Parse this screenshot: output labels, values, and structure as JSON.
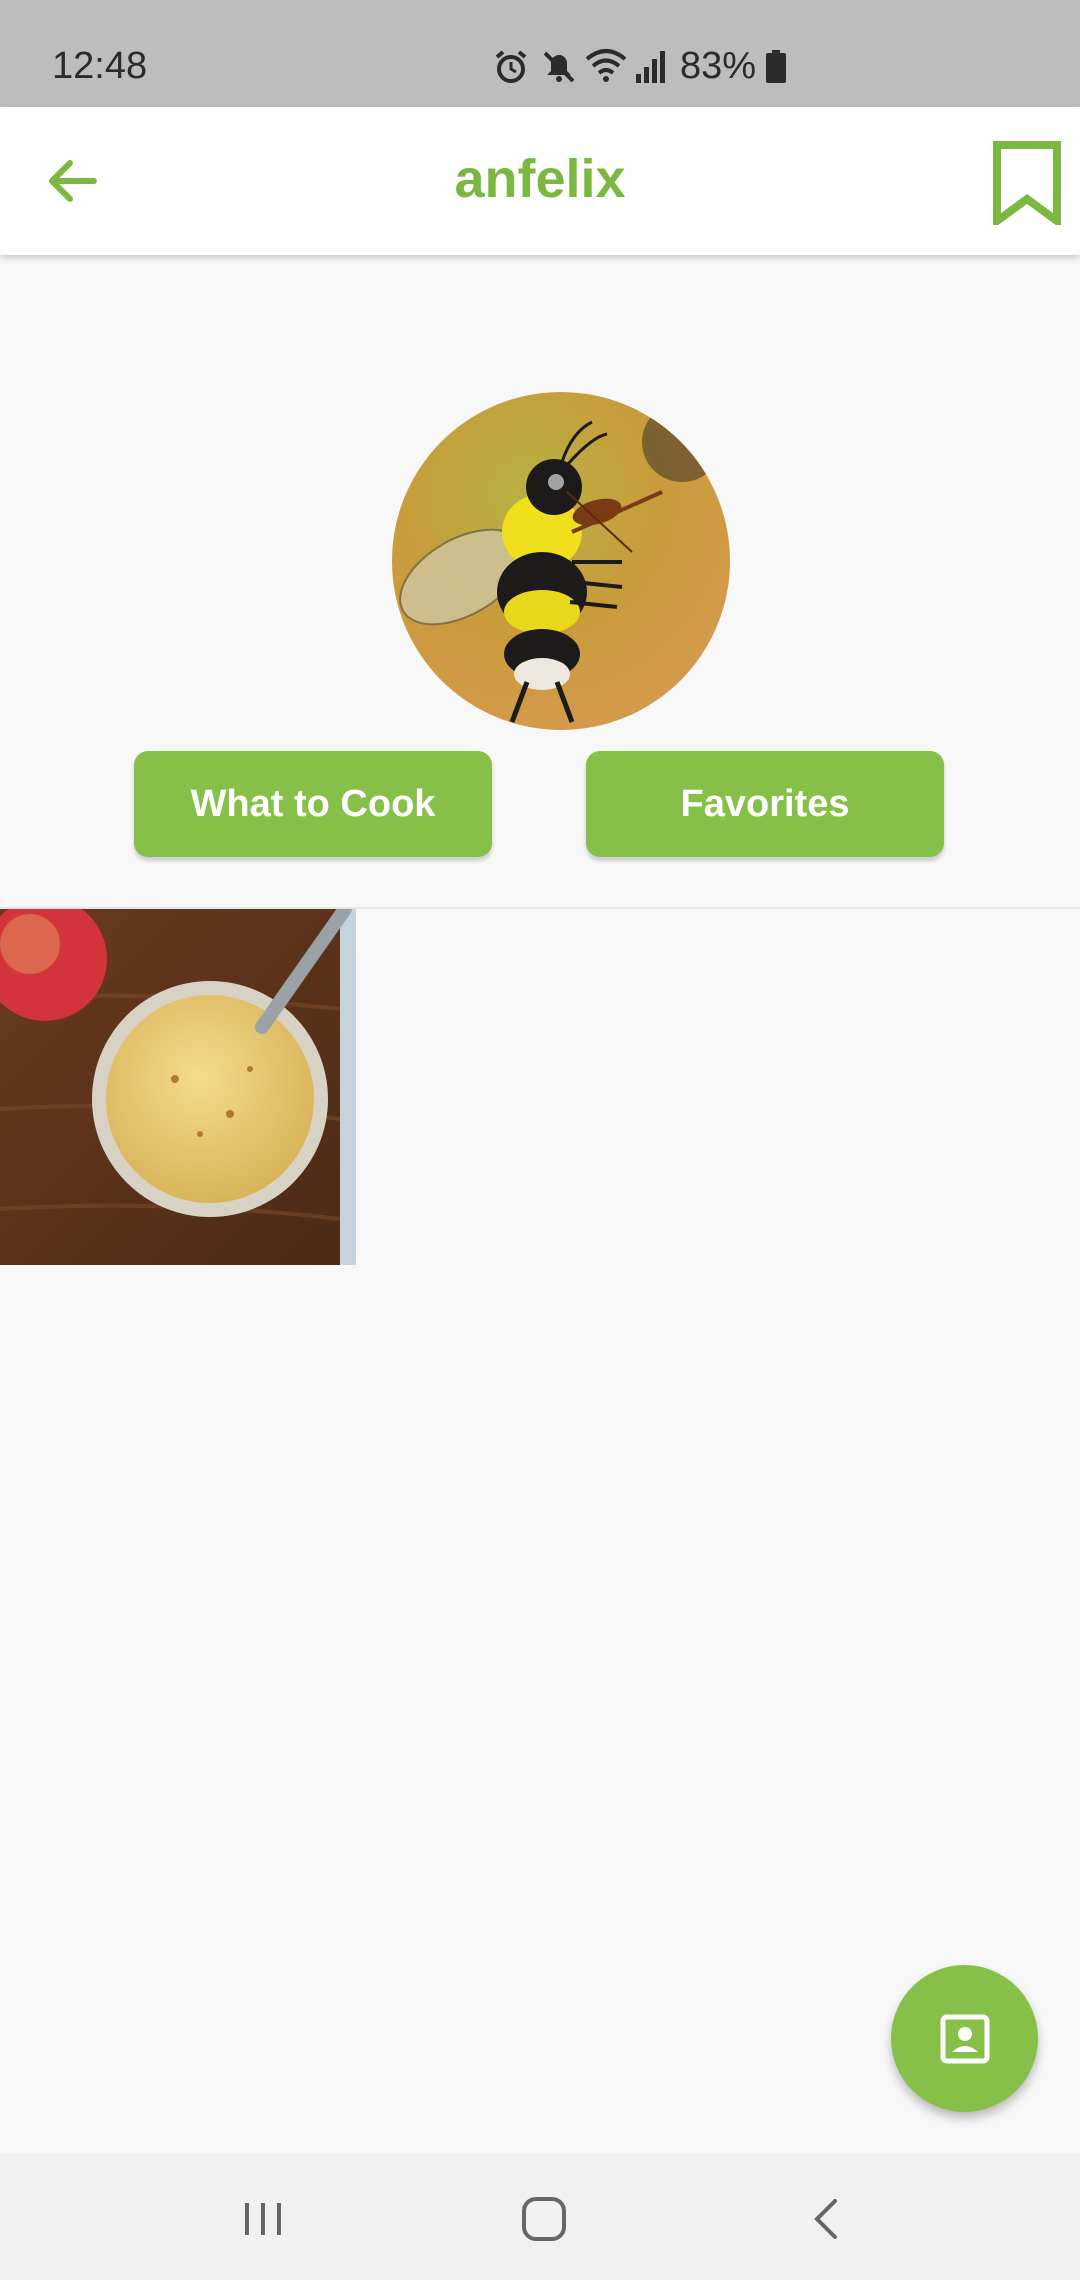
{
  "status_bar": {
    "time": "12:48",
    "battery": "83%",
    "icons": [
      "alarm-icon",
      "mute-icon",
      "wifi-icon",
      "signal-icon",
      "battery-icon"
    ]
  },
  "app_bar": {
    "title": "anfelix",
    "back_icon": "arrow-left-icon",
    "bookmark_icon": "bookmark-icon"
  },
  "profile": {
    "avatar_icon": "bee-violin-avatar",
    "buttons": {
      "what_to_cook": "What to Cook",
      "favorites": "Favorites"
    }
  },
  "recipes": [
    {
      "thumbnail_icon": "applesauce-photo"
    }
  ],
  "fab": {
    "icon": "contact-card-icon"
  },
  "colors": {
    "accent": "#86c049",
    "title": "#7cb742",
    "background": "#f8f8f8",
    "status_bar": "#bdbdbd"
  }
}
